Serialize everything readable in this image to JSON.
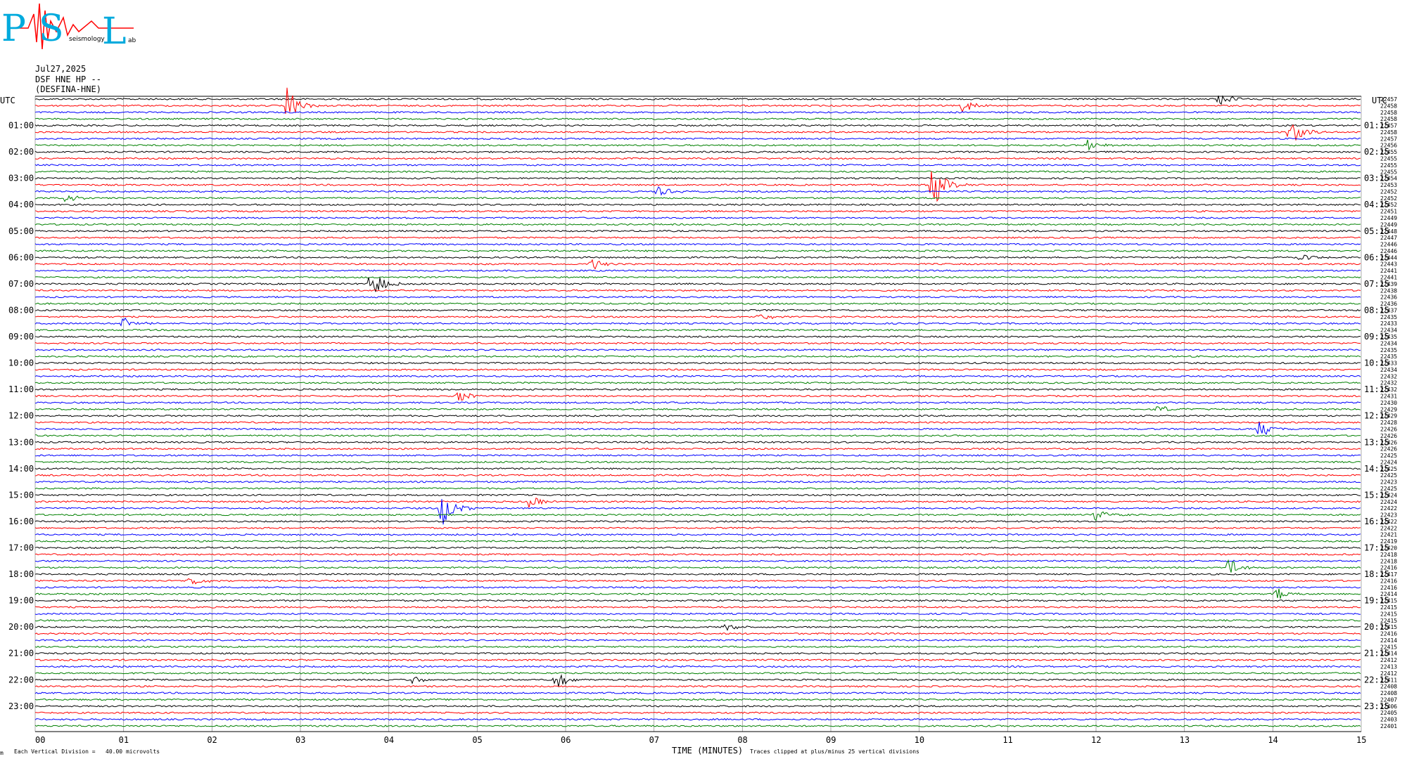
{
  "logo": {
    "letters": [
      "P",
      "S",
      "L"
    ],
    "small_text": "seismology",
    "small_lab": "ab"
  },
  "header": {
    "date": "Jul27,2025",
    "station": "DSF HNE HP --",
    "name": "(DESFINA-HNE)"
  },
  "left_utc_label": "UTC",
  "right_utc_label": "UTC",
  "footer": {
    "left_mark": "m",
    "vertical_division": "Each Vertical Division =   40.00 microvolts",
    "xlabel": "TIME (MINUTES)",
    "clip_note": "Traces clipped at plus/minus 25 vertical divisions"
  },
  "chart_data": {
    "type": "line",
    "title": "",
    "xlabel": "TIME (MINUTES)",
    "ylabel": "",
    "xlim": [
      0,
      15
    ],
    "x_ticks": [
      "00",
      "01",
      "02",
      "03",
      "04",
      "05",
      "06",
      "07",
      "08",
      "09",
      "10",
      "11",
      "12",
      "13",
      "14",
      "15"
    ],
    "trace_count": 96,
    "trace_interval_minutes": 15,
    "trace_colors": [
      "#000000",
      "#ff0000",
      "#0000ff",
      "#008000"
    ],
    "left_hour_labels": [
      "01:00",
      "02:00",
      "03:00",
      "04:00",
      "05:00",
      "06:00",
      "07:00",
      "08:00",
      "09:00",
      "10:00",
      "11:00",
      "12:00",
      "13:00",
      "14:00",
      "15:00",
      "16:00",
      "17:00",
      "18:00",
      "19:00",
      "20:00",
      "21:00",
      "22:00",
      "23:00"
    ],
    "right_hour_labels": [
      "01:15",
      "02:15",
      "03:15",
      "04:15",
      "05:15",
      "06:15",
      "07:15",
      "08:15",
      "09:15",
      "10:15",
      "11:15",
      "12:15",
      "13:15",
      "14:15",
      "15:15",
      "16:15",
      "17:15",
      "18:15",
      "19:15",
      "20:15",
      "21:15",
      "22:15",
      "23:15"
    ],
    "right_trace_values": [
      "22457",
      "22458",
      "22458",
      "22458",
      "22457",
      "22458",
      "22457",
      "22456",
      "22455",
      "22455",
      "22455",
      "22455",
      "22454",
      "22453",
      "22452",
      "22452",
      "22452",
      "22451",
      "22449",
      "22449",
      "22448",
      "22447",
      "22446",
      "22446",
      "22444",
      "22443",
      "22441",
      "22441",
      "22439",
      "22438",
      "22436",
      "22436",
      "22437",
      "22435",
      "22433",
      "22434",
      "22435",
      "22434",
      "22435",
      "22435",
      "22433",
      "22434",
      "22432",
      "22432",
      "22432",
      "22431",
      "22430",
      "22429",
      "22429",
      "22428",
      "22426",
      "22426",
      "22426",
      "22426",
      "22425",
      "22424",
      "22425",
      "22425",
      "22423",
      "22425",
      "22424",
      "22424",
      "22422",
      "22423",
      "22422",
      "22422",
      "22421",
      "22419",
      "22420",
      "22418",
      "22418",
      "22416",
      "22417",
      "22416",
      "22416",
      "22414",
      "22415",
      "22415",
      "22415",
      "22415",
      "22415",
      "22416",
      "22414",
      "22415",
      "22414",
      "22412",
      "22413",
      "22412",
      "22411",
      "22408",
      "22408",
      "22407",
      "22406",
      "22405",
      "22403",
      "22401"
    ],
    "events": [
      {
        "trace": 1,
        "minute": 2.85,
        "amplitude": 3.0
      },
      {
        "trace": 1,
        "minute": 10.5,
        "amplitude": 1.4
      },
      {
        "trace": 0,
        "minute": 13.4,
        "amplitude": 1.2
      },
      {
        "trace": 5,
        "minute": 14.2,
        "amplitude": 2.6
      },
      {
        "trace": 7,
        "minute": 11.9,
        "amplitude": 1.2
      },
      {
        "trace": 13,
        "minute": 10.15,
        "amplitude": 4.0
      },
      {
        "trace": 14,
        "minute": 7.05,
        "amplitude": 1.0
      },
      {
        "trace": 15,
        "minute": 0.35,
        "amplitude": 0.9
      },
      {
        "trace": 25,
        "minute": 6.3,
        "amplitude": 1.0
      },
      {
        "trace": 24,
        "minute": 14.3,
        "amplitude": 0.8
      },
      {
        "trace": 28,
        "minute": 3.8,
        "amplitude": 2.8
      },
      {
        "trace": 33,
        "minute": 8.2,
        "amplitude": 0.8
      },
      {
        "trace": 34,
        "minute": 1.0,
        "amplitude": 1.1
      },
      {
        "trace": 45,
        "minute": 4.8,
        "amplitude": 1.1
      },
      {
        "trace": 47,
        "minute": 12.7,
        "amplitude": 0.9
      },
      {
        "trace": 50,
        "minute": 13.85,
        "amplitude": 1.6
      },
      {
        "trace": 61,
        "minute": 5.6,
        "amplitude": 1.2
      },
      {
        "trace": 62,
        "minute": 4.6,
        "amplitude": 3.2
      },
      {
        "trace": 63,
        "minute": 12.0,
        "amplitude": 1.0
      },
      {
        "trace": 73,
        "minute": 1.75,
        "amplitude": 1.0
      },
      {
        "trace": 71,
        "minute": 13.5,
        "amplitude": 1.6
      },
      {
        "trace": 75,
        "minute": 14.05,
        "amplitude": 1.1
      },
      {
        "trace": 88,
        "minute": 5.9,
        "amplitude": 1.6
      },
      {
        "trace": 88,
        "minute": 4.25,
        "amplitude": 0.8
      },
      {
        "trace": 80,
        "minute": 7.8,
        "amplitude": 0.8
      }
    ],
    "grid": true
  }
}
